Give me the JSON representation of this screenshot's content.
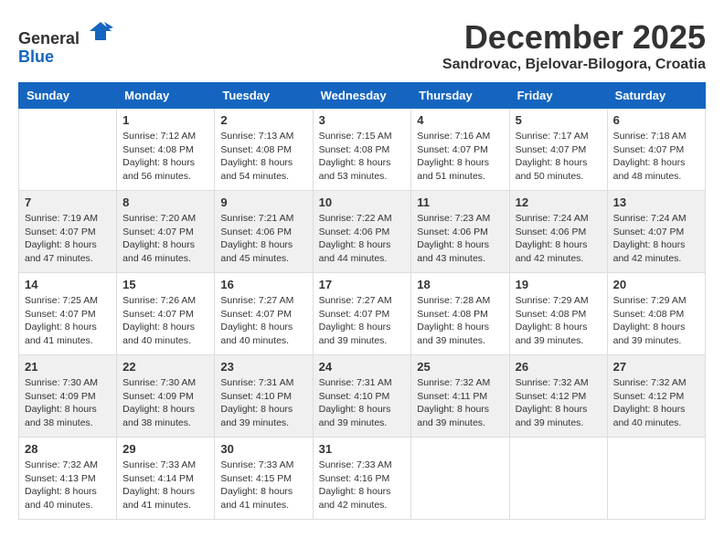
{
  "logo": {
    "general": "General",
    "blue": "Blue"
  },
  "title": "December 2025",
  "location": "Sandrovac, Bjelovar-Bilogora, Croatia",
  "days_of_week": [
    "Sunday",
    "Monday",
    "Tuesday",
    "Wednesday",
    "Thursday",
    "Friday",
    "Saturday"
  ],
  "weeks": [
    {
      "shaded": false,
      "days": [
        {
          "day": "",
          "info": ""
        },
        {
          "day": "1",
          "info": "Sunrise: 7:12 AM\nSunset: 4:08 PM\nDaylight: 8 hours\nand 56 minutes."
        },
        {
          "day": "2",
          "info": "Sunrise: 7:13 AM\nSunset: 4:08 PM\nDaylight: 8 hours\nand 54 minutes."
        },
        {
          "day": "3",
          "info": "Sunrise: 7:15 AM\nSunset: 4:08 PM\nDaylight: 8 hours\nand 53 minutes."
        },
        {
          "day": "4",
          "info": "Sunrise: 7:16 AM\nSunset: 4:07 PM\nDaylight: 8 hours\nand 51 minutes."
        },
        {
          "day": "5",
          "info": "Sunrise: 7:17 AM\nSunset: 4:07 PM\nDaylight: 8 hours\nand 50 minutes."
        },
        {
          "day": "6",
          "info": "Sunrise: 7:18 AM\nSunset: 4:07 PM\nDaylight: 8 hours\nand 48 minutes."
        }
      ]
    },
    {
      "shaded": true,
      "days": [
        {
          "day": "7",
          "info": "Sunrise: 7:19 AM\nSunset: 4:07 PM\nDaylight: 8 hours\nand 47 minutes."
        },
        {
          "day": "8",
          "info": "Sunrise: 7:20 AM\nSunset: 4:07 PM\nDaylight: 8 hours\nand 46 minutes."
        },
        {
          "day": "9",
          "info": "Sunrise: 7:21 AM\nSunset: 4:06 PM\nDaylight: 8 hours\nand 45 minutes."
        },
        {
          "day": "10",
          "info": "Sunrise: 7:22 AM\nSunset: 4:06 PM\nDaylight: 8 hours\nand 44 minutes."
        },
        {
          "day": "11",
          "info": "Sunrise: 7:23 AM\nSunset: 4:06 PM\nDaylight: 8 hours\nand 43 minutes."
        },
        {
          "day": "12",
          "info": "Sunrise: 7:24 AM\nSunset: 4:06 PM\nDaylight: 8 hours\nand 42 minutes."
        },
        {
          "day": "13",
          "info": "Sunrise: 7:24 AM\nSunset: 4:07 PM\nDaylight: 8 hours\nand 42 minutes."
        }
      ]
    },
    {
      "shaded": false,
      "days": [
        {
          "day": "14",
          "info": "Sunrise: 7:25 AM\nSunset: 4:07 PM\nDaylight: 8 hours\nand 41 minutes."
        },
        {
          "day": "15",
          "info": "Sunrise: 7:26 AM\nSunset: 4:07 PM\nDaylight: 8 hours\nand 40 minutes."
        },
        {
          "day": "16",
          "info": "Sunrise: 7:27 AM\nSunset: 4:07 PM\nDaylight: 8 hours\nand 40 minutes."
        },
        {
          "day": "17",
          "info": "Sunrise: 7:27 AM\nSunset: 4:07 PM\nDaylight: 8 hours\nand 39 minutes."
        },
        {
          "day": "18",
          "info": "Sunrise: 7:28 AM\nSunset: 4:08 PM\nDaylight: 8 hours\nand 39 minutes."
        },
        {
          "day": "19",
          "info": "Sunrise: 7:29 AM\nSunset: 4:08 PM\nDaylight: 8 hours\nand 39 minutes."
        },
        {
          "day": "20",
          "info": "Sunrise: 7:29 AM\nSunset: 4:08 PM\nDaylight: 8 hours\nand 39 minutes."
        }
      ]
    },
    {
      "shaded": true,
      "days": [
        {
          "day": "21",
          "info": "Sunrise: 7:30 AM\nSunset: 4:09 PM\nDaylight: 8 hours\nand 38 minutes."
        },
        {
          "day": "22",
          "info": "Sunrise: 7:30 AM\nSunset: 4:09 PM\nDaylight: 8 hours\nand 38 minutes."
        },
        {
          "day": "23",
          "info": "Sunrise: 7:31 AM\nSunset: 4:10 PM\nDaylight: 8 hours\nand 39 minutes."
        },
        {
          "day": "24",
          "info": "Sunrise: 7:31 AM\nSunset: 4:10 PM\nDaylight: 8 hours\nand 39 minutes."
        },
        {
          "day": "25",
          "info": "Sunrise: 7:32 AM\nSunset: 4:11 PM\nDaylight: 8 hours\nand 39 minutes."
        },
        {
          "day": "26",
          "info": "Sunrise: 7:32 AM\nSunset: 4:12 PM\nDaylight: 8 hours\nand 39 minutes."
        },
        {
          "day": "27",
          "info": "Sunrise: 7:32 AM\nSunset: 4:12 PM\nDaylight: 8 hours\nand 40 minutes."
        }
      ]
    },
    {
      "shaded": false,
      "days": [
        {
          "day": "28",
          "info": "Sunrise: 7:32 AM\nSunset: 4:13 PM\nDaylight: 8 hours\nand 40 minutes."
        },
        {
          "day": "29",
          "info": "Sunrise: 7:33 AM\nSunset: 4:14 PM\nDaylight: 8 hours\nand 41 minutes."
        },
        {
          "day": "30",
          "info": "Sunrise: 7:33 AM\nSunset: 4:15 PM\nDaylight: 8 hours\nand 41 minutes."
        },
        {
          "day": "31",
          "info": "Sunrise: 7:33 AM\nSunset: 4:16 PM\nDaylight: 8 hours\nand 42 minutes."
        },
        {
          "day": "",
          "info": ""
        },
        {
          "day": "",
          "info": ""
        },
        {
          "day": "",
          "info": ""
        }
      ]
    }
  ]
}
